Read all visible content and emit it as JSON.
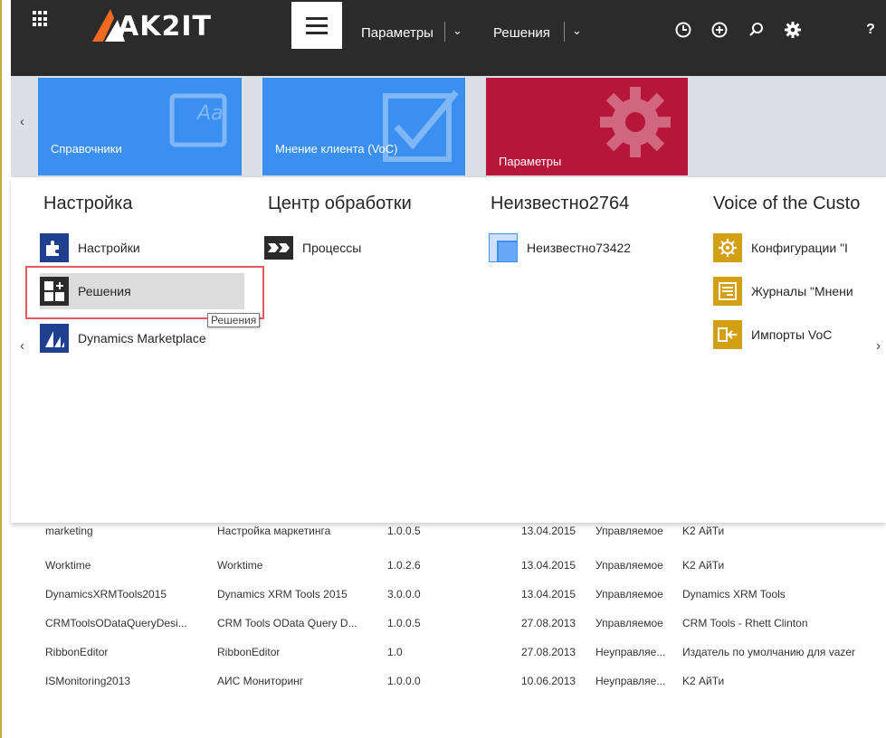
{
  "brand": {
    "logo_text": "AK2IT",
    "accent": "#f26a21"
  },
  "nav": {
    "parameters_label": "Параметры",
    "solutions_label": "Решения",
    "icons": [
      "history-icon",
      "add-icon",
      "search-icon",
      "gear-icon",
      "help-icon"
    ],
    "help_label": "?"
  },
  "tiles": [
    {
      "label": "Справочники",
      "color": "#3b8ff0",
      "icon": "book-icon",
      "icon_text": "Aa"
    },
    {
      "label": "Мнение клиента (VoC)",
      "color": "#3b8ff0",
      "icon": "checkbox-icon"
    },
    {
      "label": "Параметры",
      "color": "#b7163b",
      "icon": "gear-icon"
    }
  ],
  "groups": [
    {
      "title": "Настройка",
      "items": [
        {
          "label": "Настройки",
          "icon": "puzzle-icon"
        },
        {
          "label": "Решения",
          "icon": "solutions-icon"
        },
        {
          "label": "Dynamics Marketplace",
          "icon": "marketplace-icon"
        }
      ]
    },
    {
      "title": "Центр обработки",
      "items": [
        {
          "label": "Процессы",
          "icon": "process-icon"
        }
      ]
    },
    {
      "title": "Неизвестно2764",
      "items": [
        {
          "label": "Неизвестно73422",
          "icon": "entity-icon"
        }
      ]
    },
    {
      "title": "Voice of the Custo",
      "items": [
        {
          "label": "Конфигурации \"I",
          "icon": "config-icon"
        },
        {
          "label": "Журналы \"Мнени",
          "icon": "journal-icon"
        },
        {
          "label": "Импорты VoC",
          "icon": "import-icon"
        }
      ]
    }
  ],
  "tooltip": "Решения",
  "table": {
    "rows": [
      [
        "marketing",
        "Настройка маркетинга",
        "1.0.0.5",
        "13.04.2015",
        "Управляемое",
        "K2 АйТи"
      ],
      [
        "Worktime",
        "Worktime",
        "1.0.2.6",
        "13.04.2015",
        "Управляемое",
        "K2 АйТи"
      ],
      [
        "DynamicsXRMTools2015",
        "Dynamics XRM Tools 2015",
        "3.0.0.0",
        "13.04.2015",
        "Управляемое",
        "Dynamics XRM Tools"
      ],
      [
        "CRMToolsODataQueryDesi...",
        "CRM Tools OData Query D...",
        "1.0.0.5",
        "27.08.2013",
        "Управляемое",
        "CRM Tools - Rhett Clinton"
      ],
      [
        "RibbonEditor",
        "RibbonEditor",
        "1.0",
        "27.08.2013",
        "Неуправляе...",
        "Издатель по умолчанию для vazer"
      ],
      [
        "ISMonitoring2013",
        "АИС Мониторинг",
        "1.0.0.0",
        "10.06.2013",
        "Неуправляе...",
        "K2 АйТи"
      ]
    ]
  }
}
